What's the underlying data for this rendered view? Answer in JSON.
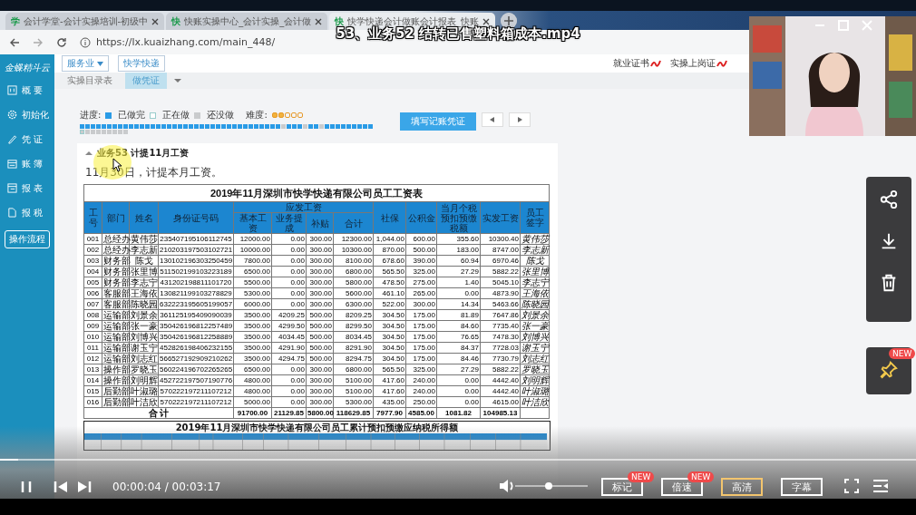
{
  "video": {
    "title": "53、业务52 结转已售塑料箱成本.mp4",
    "time": "00:00:04 / 00:03:17",
    "progress": {
      "level": 0.02
    },
    "volume": {
      "level": 0.46
    },
    "buttons": [
      {
        "label": "标记",
        "badge": "NEW",
        "selected": false
      },
      {
        "label": "倍速",
        "badge": "NEW",
        "selected": false
      },
      {
        "label": "高清",
        "selected": true
      },
      {
        "label": "字幕",
        "selected": false
      }
    ],
    "side_badge": "NEW"
  },
  "browser": {
    "tabs": [
      {
        "label": "会计学堂-会计实操培训-初级中",
        "icon": "学",
        "selected": false
      },
      {
        "label": "快账实操中心_会计实操_会计做",
        "icon": "快",
        "selected": false
      },
      {
        "label": "快学快递会计做账会计报表_快账",
        "icon": "快",
        "selected": true
      }
    ],
    "address": "https://lx.kuaizhang.com/main_448/"
  },
  "sidebar": {
    "logo": "金蝶精斗云",
    "items": [
      {
        "label": "概 要"
      },
      {
        "label": "初始化"
      },
      {
        "label": "凭 证"
      },
      {
        "label": "账 簿"
      },
      {
        "label": "报 表"
      },
      {
        "label": "报 税"
      }
    ],
    "button": "操作流程"
  },
  "topbar": {
    "industry": "服务业",
    "company": "快学快递",
    "links": [
      "就业证书",
      "实操上岗证"
    ]
  },
  "tabs": [
    {
      "label": "实操目录表",
      "selected": false
    },
    {
      "label": "做凭证",
      "selected": true
    }
  ],
  "progress": {
    "label": "进度:",
    "legend": [
      {
        "label": "已做完",
        "kind": "done"
      },
      {
        "label": "正在做",
        "kind": "current"
      },
      {
        "label": "还没做",
        "kind": "todo"
      }
    ],
    "difficulty_label": "难度:",
    "stars": 2,
    "cells": [
      {
        "done": true,
        "current": false
      },
      {
        "done": true,
        "current": false
      },
      {
        "done": true,
        "current": false
      },
      {
        "done": true,
        "current": false
      },
      {
        "done": true,
        "current": false
      },
      {
        "done": true,
        "current": false
      },
      {
        "done": true,
        "current": false
      },
      {
        "done": true,
        "current": false
      },
      {
        "done": true,
        "current": false
      },
      {
        "done": true,
        "current": false
      },
      {
        "done": true,
        "current": false
      },
      {
        "done": true,
        "current": false
      },
      {
        "done": true,
        "current": false
      },
      {
        "done": true,
        "current": false
      },
      {
        "done": true,
        "current": false
      },
      {
        "done": true,
        "current": false
      },
      {
        "done": true,
        "current": false
      },
      {
        "done": true,
        "current": false
      },
      {
        "done": true,
        "current": false
      },
      {
        "done": true,
        "current": false
      },
      {
        "done": true,
        "current": false
      },
      {
        "done": true,
        "current": false
      },
      {
        "done": true,
        "current": false
      },
      {
        "done": true,
        "current": false
      },
      {
        "done": true,
        "current": false
      },
      {
        "done": true,
        "current": false
      },
      {
        "done": true,
        "current": false
      },
      {
        "done": true,
        "current": false
      },
      {
        "done": true,
        "current": false
      },
      {
        "done": true,
        "current": false
      },
      {
        "done": true,
        "current": false
      },
      {
        "done": true,
        "current": false
      },
      {
        "done": true,
        "current": false
      },
      {
        "done": true,
        "current": false
      },
      {
        "done": true,
        "current": false
      },
      {
        "done": true,
        "current": false
      },
      {
        "done": true,
        "current": false
      },
      {
        "done": false,
        "current": false
      },
      {
        "done": true,
        "current": false
      },
      {
        "done": true,
        "current": false
      },
      {
        "done": true,
        "current": false
      },
      {
        "done": false,
        "current": false
      },
      {
        "done": true,
        "current": false
      },
      {
        "done": true,
        "current": false
      },
      {
        "done": false,
        "current": false
      },
      {
        "done": true,
        "current": false
      },
      {
        "done": true,
        "current": false
      },
      {
        "done": true,
        "current": false
      },
      {
        "done": true,
        "current": false
      },
      {
        "done": true,
        "current": false
      },
      {
        "done": true,
        "current": false
      },
      {
        "done": true,
        "current": false
      },
      {
        "done": true,
        "current": false
      },
      {
        "done": true,
        "current": false
      },
      {
        "done": false,
        "current": true
      },
      {
        "done": false,
        "current": false
      },
      {
        "done": false,
        "current": false
      },
      {
        "done": false,
        "current": false
      },
      {
        "done": false,
        "current": false
      },
      {
        "done": false,
        "current": false
      },
      {
        "done": false,
        "current": false
      },
      {
        "done": false,
        "current": false
      },
      {
        "done": false,
        "current": false
      }
    ],
    "button": "填写记账凭证"
  },
  "task": {
    "title": "业务53 计提11月工资",
    "text": "11月30日，计提本月工资。"
  },
  "salary_table": {
    "title": "2019年11月深圳市快学快递有限公司员工工资表",
    "left_columns": [
      "工号",
      "部门",
      "姓名",
      "身份证号码"
    ],
    "group": "应发工资",
    "group_columns": [
      "基本工资",
      "业务提成",
      "补贴",
      "合计"
    ],
    "right_columns": [
      "社保",
      "公积金",
      "当月个税预扣预缴税额",
      "实发工资",
      "员工签字"
    ],
    "rows": [
      [
        "001",
        "总经办",
        "黄伟莎",
        "235407195106112745",
        "12000.00",
        "0.00",
        "300.00",
        "12300.00",
        "1,044.00",
        "600.00",
        "355.60",
        "10300.40",
        "黄伟莎"
      ],
      [
        "002",
        "总经办",
        "李志新",
        "210203197503102721",
        "10000.00",
        "0.00",
        "300.00",
        "10300.00",
        "870.00",
        "500.00",
        "183.00",
        "8747.00",
        "李志新"
      ],
      [
        "003",
        "财务部",
        "陈戈",
        "130102196303250459",
        "7800.00",
        "0.00",
        "300.00",
        "8100.00",
        "678.60",
        "390.00",
        "60.94",
        "6970.46",
        "陈戈"
      ],
      [
        "004",
        "财务部",
        "张里博",
        "511502199103223189",
        "6500.00",
        "0.00",
        "300.00",
        "6800.00",
        "565.50",
        "325.00",
        "27.29",
        "5882.22",
        "张里博"
      ],
      [
        "005",
        "财务部",
        "李志宁",
        "431202198811101720",
        "5500.00",
        "0.00",
        "300.00",
        "5800.00",
        "478.50",
        "275.00",
        "1.40",
        "5045.10",
        "李志宁"
      ],
      [
        "006",
        "客服部",
        "王海依",
        "130821199103278829",
        "5300.00",
        "0.00",
        "300.00",
        "5600.00",
        "461.10",
        "265.00",
        "0.00",
        "4873.90",
        "王海依"
      ],
      [
        "007",
        "客服部",
        "陈晓园",
        "632223195605199057",
        "6000.00",
        "0.00",
        "300.00",
        "6300.00",
        "522.00",
        "300.00",
        "14.34",
        "5463.66",
        "陈晓园"
      ],
      [
        "008",
        "运输部",
        "刘景余",
        "361125195409090039",
        "3500.00",
        "4209.25",
        "500.00",
        "8209.25",
        "304.50",
        "175.00",
        "81.89",
        "7647.86",
        "刘景余"
      ],
      [
        "009",
        "运输部",
        "张一豪",
        "350426196812257489",
        "3500.00",
        "4299.50",
        "500.00",
        "8299.50",
        "304.50",
        "175.00",
        "84.60",
        "7735.40",
        "张一豪"
      ],
      [
        "010",
        "运输部",
        "刘博兴",
        "350426196812258889",
        "3500.00",
        "4034.45",
        "500.00",
        "8034.45",
        "304.50",
        "175.00",
        "76.65",
        "7478.30",
        "刘博兴"
      ],
      [
        "011",
        "运输部",
        "谢玉宁",
        "452826198406232155",
        "3500.00",
        "4291.90",
        "500.00",
        "8291.90",
        "304.50",
        "175.00",
        "84.37",
        "7728.03",
        "谢玉宁"
      ],
      [
        "012",
        "运输部",
        "刘志红",
        "566527192909210262",
        "3500.00",
        "4294.75",
        "500.00",
        "8294.75",
        "304.50",
        "175.00",
        "84.46",
        "7730.79",
        "刘志红"
      ],
      [
        "013",
        "操作部",
        "罗晓玉",
        "560224196702265265",
        "6500.00",
        "0.00",
        "300.00",
        "6800.00",
        "565.50",
        "325.00",
        "27.29",
        "5882.22",
        "罗晓玉"
      ],
      [
        "014",
        "操作部",
        "刘明辉",
        "452722197507190776",
        "4800.00",
        "0.00",
        "300.00",
        "5100.00",
        "417.60",
        "240.00",
        "0.00",
        "4442.40",
        "刘明辉"
      ],
      [
        "015",
        "后勤部",
        "叶淑璐",
        "570222197211107212",
        "4800.00",
        "0.00",
        "300.00",
        "5100.00",
        "417.60",
        "240.00",
        "0.00",
        "4442.40",
        "叶淑璐"
      ],
      [
        "016",
        "后勤部",
        "叶洁欣",
        "570222197211107212",
        "5000.00",
        "0.00",
        "300.00",
        "5300.00",
        "435.00",
        "250.00",
        "0.00",
        "4615.00",
        "叶洁欣"
      ]
    ],
    "total": {
      "label": "合 计",
      "values": [
        "91700.00",
        "21129.85",
        "5800.00",
        "118629.85",
        "7977.90",
        "4585.00",
        "1081.82",
        "104985.13"
      ]
    }
  },
  "tax_table": {
    "title": "2019年11月深圳市快学快递有限公司员工累计预扣预缴应纳税所得额"
  }
}
